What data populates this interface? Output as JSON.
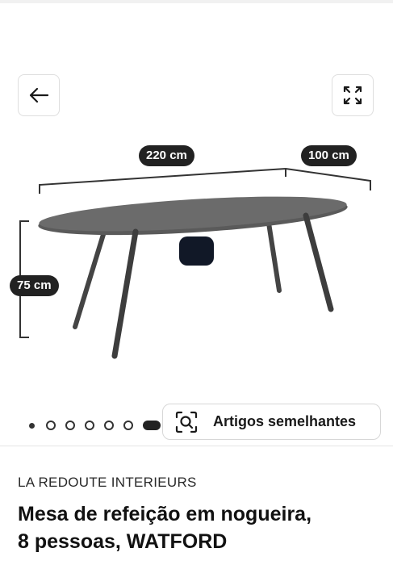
{
  "gallery": {
    "dimensions": {
      "length": "220 cm",
      "width": "100 cm",
      "height": "75 cm"
    },
    "pagination": {
      "total_dots": 7,
      "active_index": 6
    },
    "similar_items_label": "Artigos semelhantes",
    "icons": {
      "back": "arrow-left-icon",
      "expand": "expand-icon",
      "similar": "visual-search-icon"
    }
  },
  "product": {
    "brand": "LA REDOUTE INTERIEURS",
    "title_line1": "Mesa de refeição em nogueira,",
    "title_line2": "8 pessoas, WATFORD"
  },
  "colors": {
    "pill_bg": "#222222",
    "chip_bg": "#111827",
    "table_top": "#555555"
  }
}
